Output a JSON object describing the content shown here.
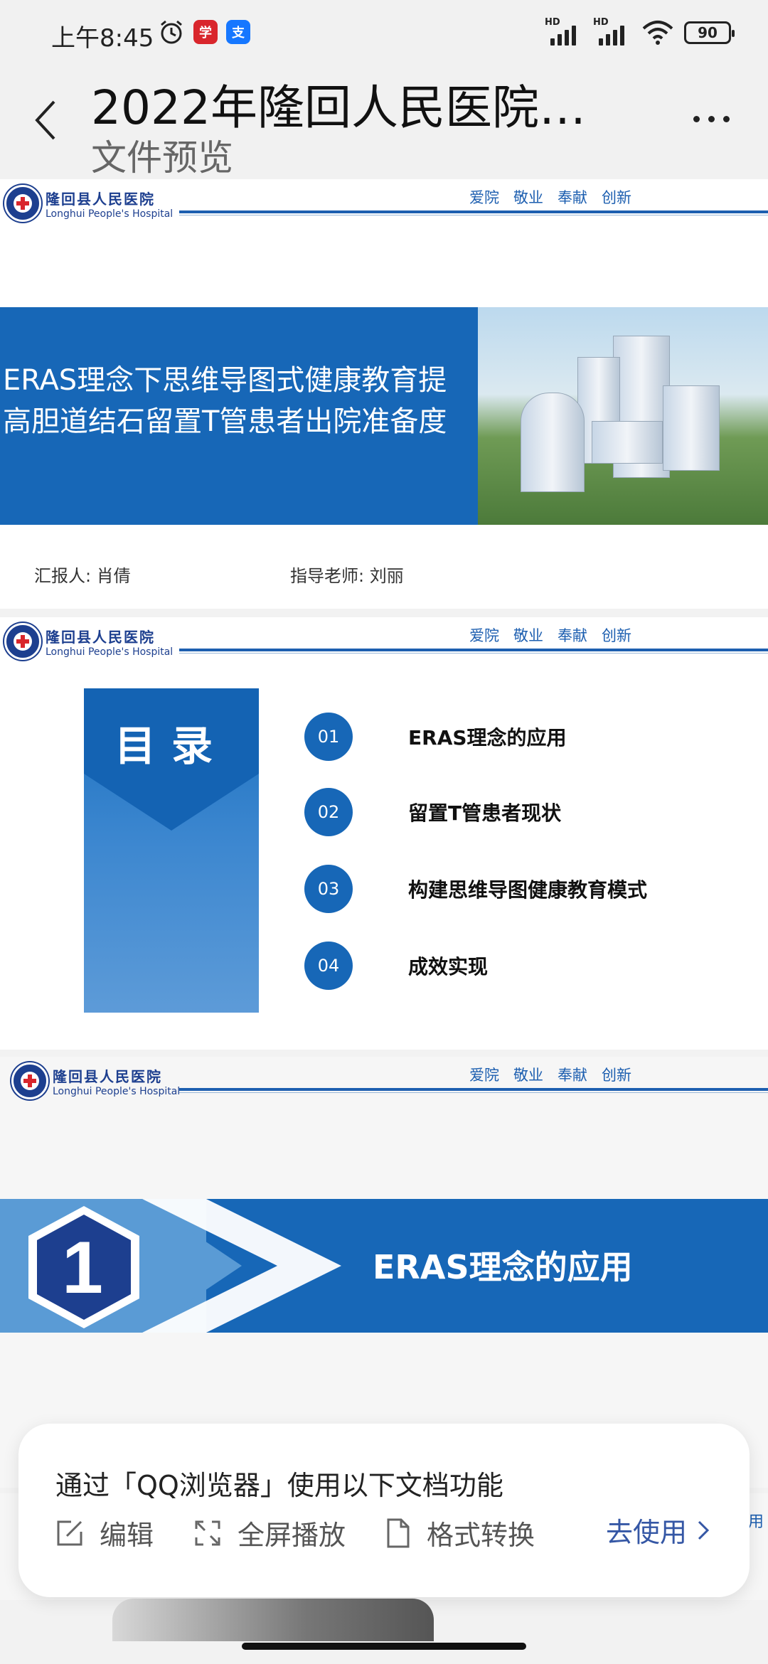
{
  "status_bar": {
    "time": "上午8:45",
    "app_badge_red": "学",
    "app_badge_blue": "支",
    "hd1": "HD",
    "hd2": "HD",
    "battery": "90"
  },
  "header": {
    "title": "2022年隆回人民医院…",
    "subtitle": "文件预览"
  },
  "hospital": {
    "name_cn": "隆回县人民医院",
    "name_en": "Longhui People's Hospital",
    "motto": [
      "爱院",
      "敬业",
      "奉献",
      "创新"
    ]
  },
  "slide1": {
    "title": "ERAS理念下思维导图式健康教育提高胆道结石留置T管患者出院准备度",
    "reporter": "汇报人: 肖倩",
    "advisor": "指导老师: 刘丽"
  },
  "slide2": {
    "toc_title": "目录",
    "items": [
      {
        "num": "01",
        "label": "ERAS理念的应用"
      },
      {
        "num": "02",
        "label": "留置T管患者现状"
      },
      {
        "num": "03",
        "label": "构建思维导图健康教育模式"
      },
      {
        "num": "04",
        "label": "成效实现"
      }
    ]
  },
  "slide3": {
    "number": "1",
    "title": "ERAS理念的应用"
  },
  "slide4_peek": {
    "motto_fragment": "用"
  },
  "qq_popup": {
    "text": "通过「QQ浏览器」使用以下文档功能",
    "actions": [
      "编辑",
      "全屏播放",
      "格式转换"
    ],
    "go": "去使用"
  },
  "colors": {
    "brand_blue": "#1767b7",
    "light_blue": "#5a9bd5",
    "link_blue": "#3557a5"
  }
}
